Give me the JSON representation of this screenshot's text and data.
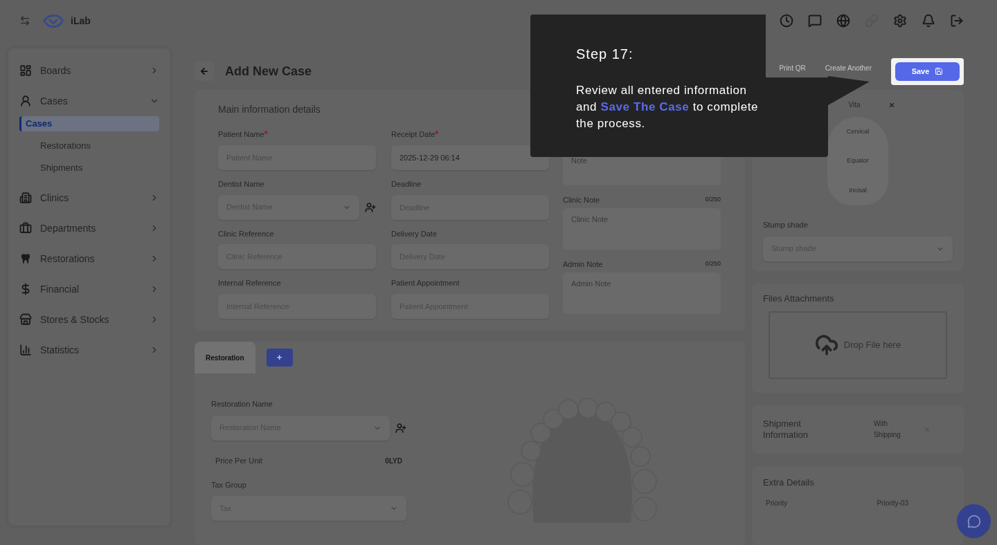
{
  "header": {
    "logo_text": "iLab"
  },
  "sidebar": {
    "items": [
      {
        "label": "Boards",
        "expanded": false
      },
      {
        "label": "Cases",
        "expanded": true,
        "children": [
          {
            "label": "Cases",
            "selected": true
          },
          {
            "label": "Restorations",
            "selected": false
          },
          {
            "label": "Shipments",
            "selected": false
          }
        ]
      },
      {
        "label": "Clinics",
        "expanded": false
      },
      {
        "label": "Departments",
        "expanded": false
      },
      {
        "label": "Restorations",
        "expanded": false
      },
      {
        "label": "Financial",
        "expanded": false
      },
      {
        "label": "Stores & Stocks",
        "expanded": false
      },
      {
        "label": "Statistics",
        "expanded": false
      }
    ]
  },
  "page": {
    "title": "Add New Case",
    "actions": [
      "Print QR",
      "Create Another"
    ],
    "save_button": "Save"
  },
  "main_info": {
    "title": "Main information details",
    "fields": [
      {
        "label": "Patient Name",
        "required_mark": "*",
        "kind": "input",
        "placeholder": "Patient Name"
      },
      {
        "label": "Receipt Date",
        "required_mark": "*",
        "kind": "input",
        "value": "2025-12-29 06:14"
      },
      {
        "label": "Dentist Name",
        "kind": "select",
        "placeholder": "Dentist Name"
      },
      {
        "label": "Deadline",
        "kind": "input",
        "placeholder": "Deadline"
      },
      {
        "label": "Clinic Reference",
        "kind": "input",
        "placeholder": "Clinic Reference"
      },
      {
        "label": "Delivery Date",
        "kind": "input",
        "placeholder": "Delivery Date"
      },
      {
        "label": "Internal Reference",
        "kind": "input",
        "placeholder": "Internal Reference"
      },
      {
        "label": "Patient Appointment",
        "kind": "input",
        "placeholder": "Patient Appointment"
      }
    ],
    "notes": [
      {
        "placeholder": "Note"
      },
      {
        "label": "Clinic Note",
        "counter": "0/250",
        "placeholder": "Clinic Note"
      },
      {
        "label": "Admin Note",
        "counter": "0/250",
        "placeholder": "Admin Note"
      }
    ]
  },
  "restoration": {
    "tabs": [
      {
        "label": "Restoration",
        "selected": true
      }
    ],
    "add_button": "+",
    "name_label": "Restoration Name",
    "name_placeholder": "Restoration Name",
    "price_label": "Price Per Unit",
    "price_value": "0LYD",
    "tax_label": "Tax Group",
    "tax_placeholder": "Tax"
  },
  "shade": {
    "system": "Vita",
    "zones": [
      "Cervical",
      "Equator",
      "Incisal"
    ],
    "stump_label": "Stump shade",
    "stump_placeholder": "Stump shade"
  },
  "files": {
    "title": "Files Attachments",
    "drop_text": "Drop File here"
  },
  "shipment": {
    "title": "Shipment Information",
    "value": "With Shipping"
  },
  "extra": {
    "title": "Extra Details",
    "rows": [
      {
        "label": "Priority",
        "value": "Priority-03"
      }
    ]
  },
  "tooltip": {
    "title": "Step 17:",
    "text": "Review all entered information and **Save The Case** to complete the process."
  }
}
